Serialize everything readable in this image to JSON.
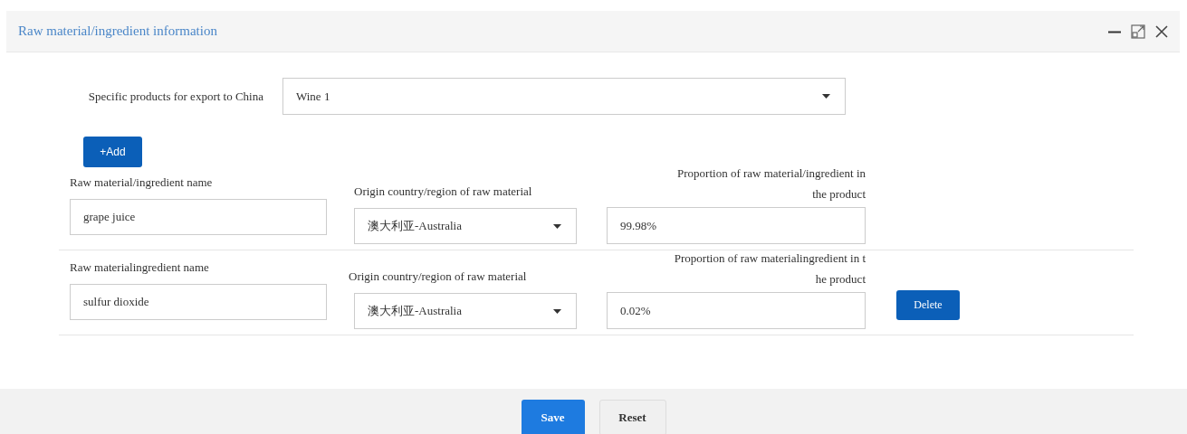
{
  "dialog": {
    "title": "Raw material/ingredient information"
  },
  "product": {
    "label": "Specific products for export to China",
    "value": "Wine 1"
  },
  "add_button": "+Add",
  "rows": [
    {
      "name_label": "Raw material/ingredient name",
      "name_value": "grape juice",
      "origin_label": "Origin country/region of raw material",
      "origin_value": "澳大利亚-Australia",
      "proportion_label": "Proportion of raw material/ingredient in\nthe product",
      "proportion_value": "99.98%"
    },
    {
      "name_label": "Raw materialingredient name",
      "name_value": "sulfur dioxide",
      "origin_label": "Origin country/region of raw material",
      "origin_value": "澳大利亚-Australia",
      "proportion_label": "Proportion of raw materialingredient in t\nhe product",
      "proportion_value": "0.02%",
      "delete_button": "Delete"
    }
  ],
  "footer_buttons": [
    {
      "label": "Save",
      "kind": "primary"
    },
    {
      "label": "Reset",
      "kind": "default"
    }
  ]
}
